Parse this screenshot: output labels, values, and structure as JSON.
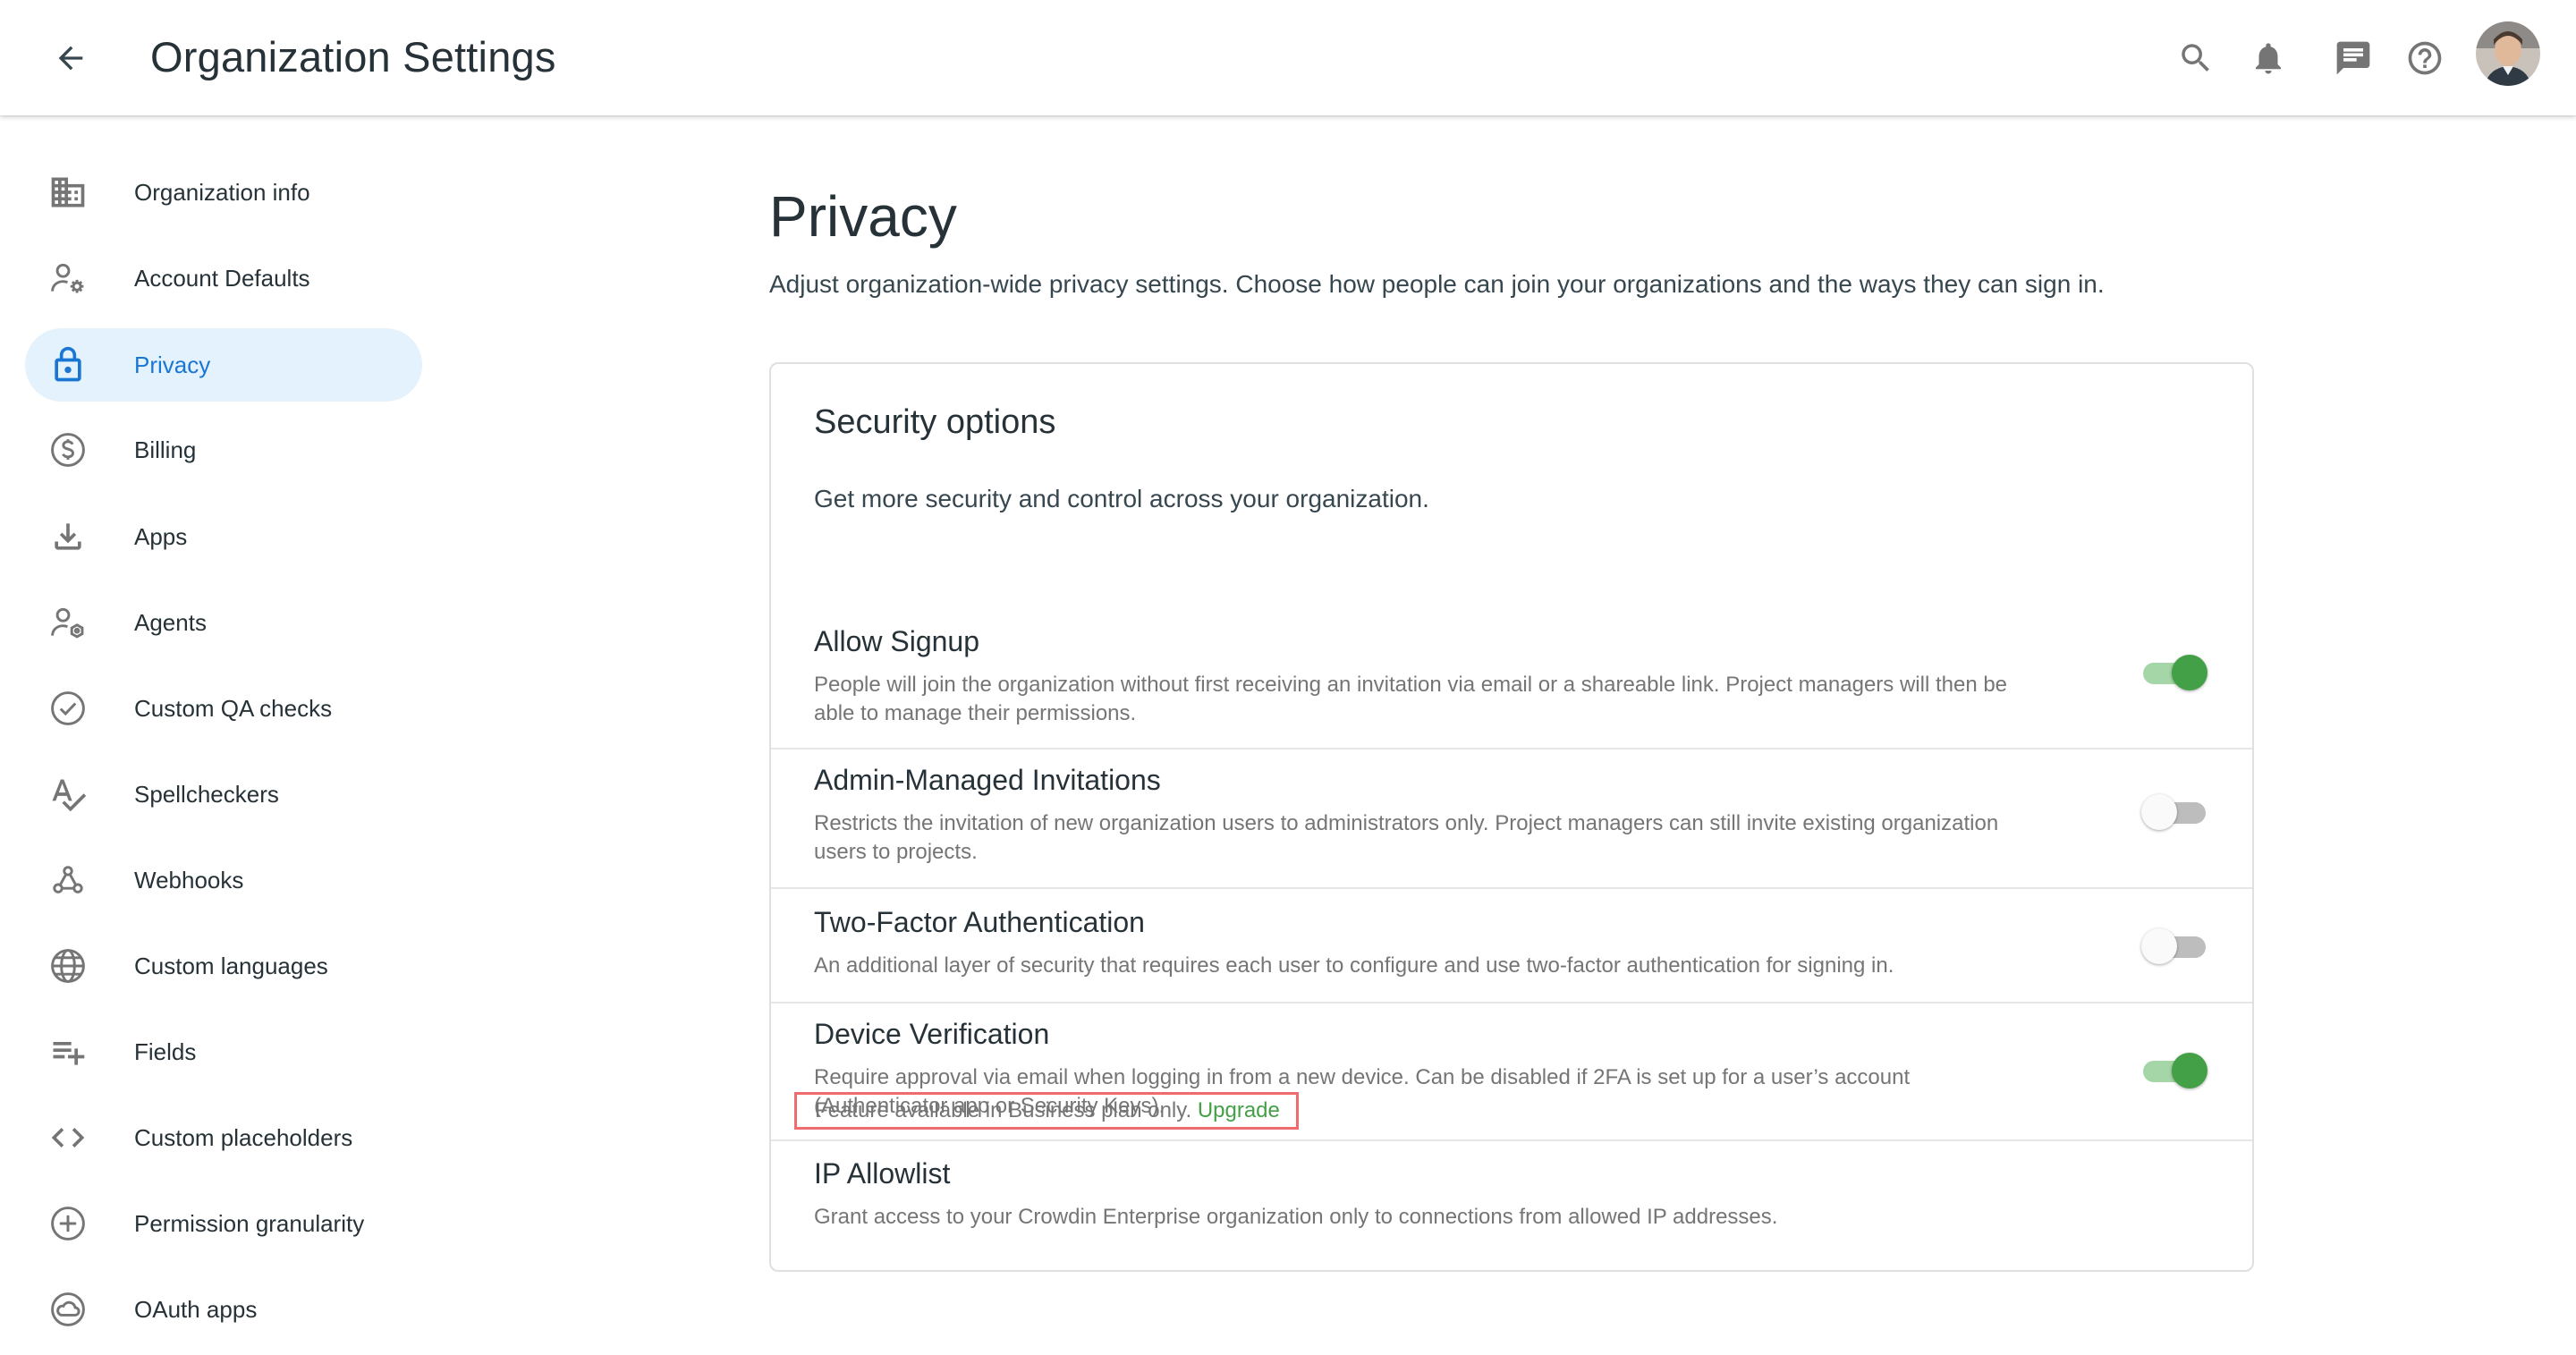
{
  "header": {
    "title": "Organization Settings",
    "icons": [
      "back-arrow-icon",
      "search-icon",
      "bell-icon",
      "message-icon",
      "help-icon",
      "avatar"
    ]
  },
  "sidebar": {
    "items": [
      {
        "label": "Organization info",
        "icon": "building-icon"
      },
      {
        "label": "Account Defaults",
        "icon": "user-settings-icon"
      },
      {
        "label": "Privacy",
        "icon": "lock-icon",
        "active": true
      },
      {
        "label": "Billing",
        "icon": "dollar-icon"
      },
      {
        "label": "Apps",
        "icon": "download-icon"
      },
      {
        "label": "Agents",
        "icon": "user-agent-icon"
      },
      {
        "label": "Custom QA checks",
        "icon": "check-circle-icon"
      },
      {
        "label": "Spellcheckers",
        "icon": "spellcheck-icon"
      },
      {
        "label": "Webhooks",
        "icon": "webhook-icon"
      },
      {
        "label": "Custom languages",
        "icon": "globe-icon"
      },
      {
        "label": "Fields",
        "icon": "playlist-add-icon"
      },
      {
        "label": "Custom placeholders",
        "icon": "code-icon"
      },
      {
        "label": "Permission granularity",
        "icon": "plus-circle-icon"
      },
      {
        "label": "OAuth apps",
        "icon": "cloud-circle-icon"
      }
    ]
  },
  "main": {
    "title": "Privacy",
    "description": "Adjust organization-wide privacy settings. Choose how people can join your organizations and the ways they can sign in.",
    "card": {
      "title": "Security options",
      "description": "Get more security and control across your organization.",
      "options": [
        {
          "title": "Allow Signup",
          "description": "People will join the organization without first receiving an invitation via email or a shareable link. Project managers will then be able to manage their permissions.",
          "enabled": true
        },
        {
          "title": "Admin-Managed Invitations",
          "description": "Restricts the invitation of new organization users to administrators only. Project managers can still invite existing organization users to projects.",
          "enabled": false
        },
        {
          "title": "Two-Factor Authentication",
          "description": "An additional layer of security that requires each user to configure and use two-factor authentication for signing in.",
          "enabled": false
        },
        {
          "title": "Device Verification",
          "description": "Require approval via email when logging in from a new device. Can be disabled if 2FA is set up for a user’s account (Authenticator app or Security Keys).",
          "enabled": true
        },
        {
          "title": "IP Allowlist",
          "description": "Grant access to your Crowdin Enterprise organization only to connections from allowed IP addresses."
        }
      ],
      "plan_note": "Feature available in Business plan only.",
      "upgrade_label": "Upgrade"
    }
  },
  "colors": {
    "accent": "#1976d2",
    "active_bg": "#e3f2fc",
    "toggle_on": "#43a047",
    "upgrade": "#43a047",
    "highlight_border": "#f06b6b"
  }
}
